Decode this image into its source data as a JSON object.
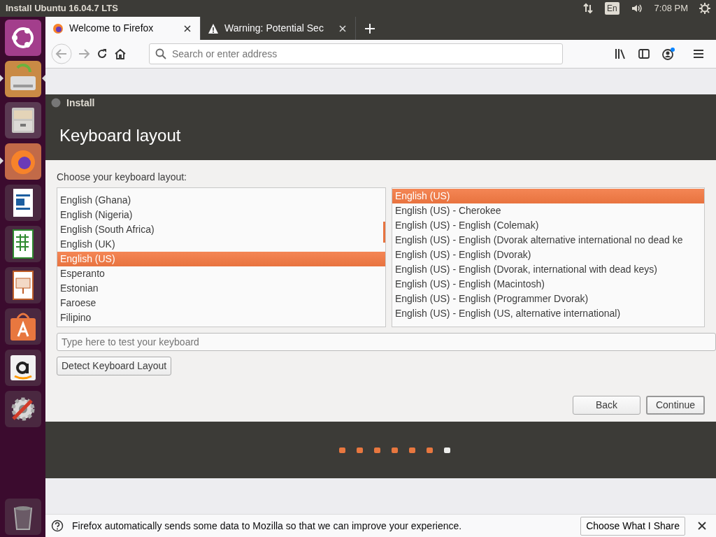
{
  "top_panel": {
    "title": "Install Ubuntu 16.04.7 LTS",
    "keyboard_indicator": "En",
    "clock": "7:08 PM"
  },
  "launcher": [
    {
      "kind": "ubuntu",
      "running": false,
      "focused": false
    },
    {
      "kind": "installer",
      "running": true,
      "focused": true
    },
    {
      "kind": "files",
      "running": false,
      "focused": false
    },
    {
      "kind": "firefox",
      "running": true,
      "focused": false
    },
    {
      "kind": "writer",
      "running": false,
      "focused": false
    },
    {
      "kind": "calc",
      "running": false,
      "focused": false
    },
    {
      "kind": "impress",
      "running": false,
      "focused": false
    },
    {
      "kind": "store",
      "running": false,
      "focused": false
    },
    {
      "kind": "amazon",
      "running": false,
      "focused": false
    },
    {
      "kind": "settings",
      "running": false,
      "focused": false
    },
    {
      "kind": "trash",
      "running": false,
      "focused": false
    }
  ],
  "browser": {
    "tabs": [
      {
        "label": "Welcome to Firefox",
        "kind": "firefox",
        "selected": true
      },
      {
        "label": "Warning: Potential Sec",
        "kind": "warning",
        "selected": false
      }
    ],
    "address_placeholder": "Search or enter address",
    "notification": {
      "text": "Firefox automatically sends some data to Mozilla so that we can improve your experience.",
      "button": "Choose What I Share"
    }
  },
  "installer": {
    "window_title": "Install",
    "heading": "Keyboard layout",
    "prompt": "Choose your keyboard layout:",
    "layouts": [
      {
        "label": "English (Ghana)",
        "selected": false
      },
      {
        "label": "English (Nigeria)",
        "selected": false
      },
      {
        "label": "English (South Africa)",
        "selected": false
      },
      {
        "label": "English (UK)",
        "selected": false
      },
      {
        "label": "English (US)",
        "selected": true
      },
      {
        "label": "Esperanto",
        "selected": false
      },
      {
        "label": "Estonian",
        "selected": false
      },
      {
        "label": "Faroese",
        "selected": false
      },
      {
        "label": "Filipino",
        "selected": false
      }
    ],
    "variants": [
      {
        "label": "English (US)",
        "selected": true
      },
      {
        "label": "English (US) - Cherokee",
        "selected": false
      },
      {
        "label": "English (US) - English (Colemak)",
        "selected": false
      },
      {
        "label": "English (US) - English (Dvorak alternative international no dead ke",
        "selected": false
      },
      {
        "label": "English (US) - English (Dvorak)",
        "selected": false
      },
      {
        "label": "English (US) - English (Dvorak, international with dead keys)",
        "selected": false
      },
      {
        "label": "English (US) - English (Macintosh)",
        "selected": false
      },
      {
        "label": "English (US) - English (Programmer Dvorak)",
        "selected": false
      },
      {
        "label": "English (US) - English (US, alternative international)",
        "selected": false
      }
    ],
    "test_placeholder": "Type here to test your keyboard",
    "detect_button": "Detect Keyboard Layout",
    "back_button": "Back",
    "continue_button": "Continue",
    "steps": [
      {
        "kind": "done"
      },
      {
        "kind": "done"
      },
      {
        "kind": "done"
      },
      {
        "kind": "done"
      },
      {
        "kind": "done"
      },
      {
        "kind": "done"
      },
      {
        "kind": "current"
      }
    ]
  }
}
